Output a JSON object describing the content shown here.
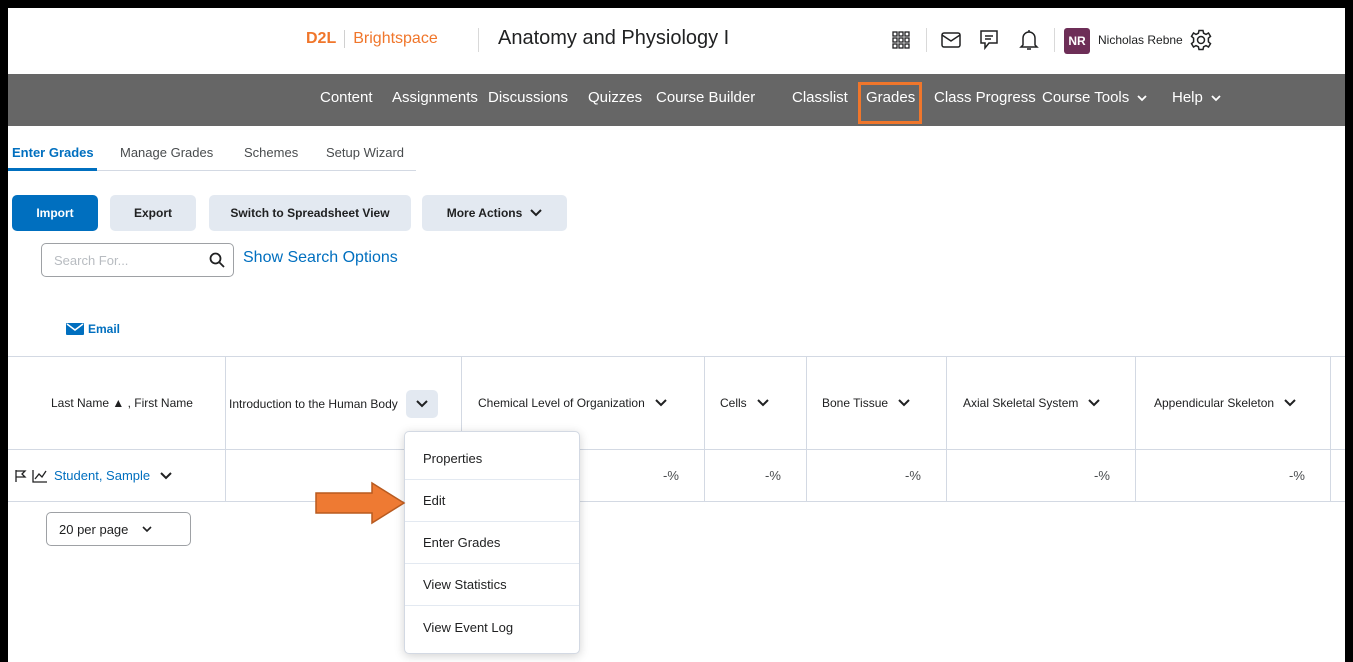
{
  "header": {
    "brand_d2l": "D2L",
    "brand_name": "Brightspace",
    "course_title": "Anatomy and Physiology I",
    "user_initials": "NR",
    "user_name": "Nicholas Rebne",
    "colors": {
      "brand": "#f0762b",
      "avatar": "#6d2e57",
      "accent": "#006fbf"
    }
  },
  "nav": {
    "items": [
      "Content",
      "Assignments",
      "Discussions",
      "Quizzes",
      "Course Builder",
      "Classlist",
      "Grades",
      "Class Progress",
      "Course Tools",
      "Help"
    ],
    "highlighted": "Grades"
  },
  "tabs": [
    "Enter Grades",
    "Manage Grades",
    "Schemes",
    "Setup Wizard"
  ],
  "toolbar": {
    "import": "Import",
    "export": "Export",
    "spreadsheet": "Switch to Spreadsheet View",
    "more_actions": "More Actions"
  },
  "search": {
    "placeholder": "Search For...",
    "show_options": "Show Search Options"
  },
  "email_label": "Email",
  "table": {
    "headers": [
      "Last Name ▲ , First Name",
      "Introduction to the Human Body",
      "Chemical Level of Organization",
      "Cells",
      "Bone Tissue",
      "Axial Skeletal System",
      "Appendicular Skeleton"
    ],
    "row": {
      "student": "Student, Sample",
      "values": [
        "-%",
        "-%",
        "-%",
        "-%",
        "-%"
      ]
    }
  },
  "per_page": "20 per page",
  "menu": {
    "items": [
      "Properties",
      "Edit",
      "Enter Grades",
      "View Statistics",
      "View Event Log"
    ]
  }
}
